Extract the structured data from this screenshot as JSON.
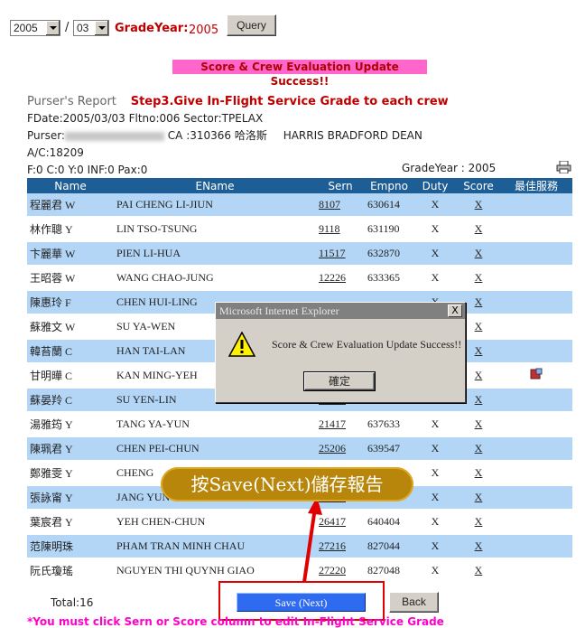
{
  "top": {
    "year_value": "2005",
    "slash": "/",
    "month_value": "03",
    "grade_year_label": "GradeYear:",
    "grade_year_value": "2005",
    "query_label": "Query"
  },
  "success_banner": "Score & Crew Evaluation Update Success!!",
  "report": {
    "title": "Purser's Report",
    "step": "Step3.Give In-Flight Service Grade to each crew",
    "line2": "FDate:2005/03/03  Fltno:006  Sector:TPELAX",
    "purser_label": "Purser:",
    "purser_ca": "CA :310366 哈洛斯",
    "purser_name": "HARRIS BRADFORD DEAN",
    "ac": "A/C:18209",
    "pax": "F:0  C:0  Y:0 INF:0   Pax:0",
    "grade_year": "GradeYear : 2005"
  },
  "table": {
    "headers": [
      "Name",
      "EName",
      "Sern",
      "Empno",
      "Duty",
      "Score",
      "最佳服務"
    ],
    "rows": [
      {
        "name": "程麗君 W",
        "ename": "PAI CHENG LI-JIUN",
        "sern": "8107",
        "empno": "630614",
        "duty": "X",
        "score": "X"
      },
      {
        "name": "林作聰 Y",
        "ename": "LIN TSO-TSUNG",
        "sern": "9118",
        "empno": "631190",
        "duty": "X",
        "score": "X"
      },
      {
        "name": "卞麗華 W",
        "ename": "PIEN LI-HUA",
        "sern": "11517",
        "empno": "632870",
        "duty": "X",
        "score": "X"
      },
      {
        "name": "王昭蓉 W",
        "ename": "WANG CHAO-JUNG",
        "sern": "12226",
        "empno": "633365",
        "duty": "X",
        "score": "X"
      },
      {
        "name": "陳惠玲 F",
        "ename": "CHEN HUI-LING",
        "sern": "",
        "empno": "",
        "duty": "X",
        "score": "X"
      },
      {
        "name": "蘇雅文 W",
        "ename": "SU YA-WEN",
        "sern": "",
        "empno": "",
        "duty": "X",
        "score": "X"
      },
      {
        "name": "韓苔蘭 C",
        "ename": "HAN TAI-LAN",
        "sern": "",
        "empno": "",
        "duty": "X",
        "score": "X"
      },
      {
        "name": "甘明曄 C",
        "ename": "KAN MING-YEH",
        "sern": "",
        "empno": "",
        "duty": "X",
        "score": "X"
      },
      {
        "name": "蘇晏羚 C",
        "ename": "SU YEN-LIN",
        "sern": "20418",
        "empno": "637230",
        "duty": "X",
        "score": "X"
      },
      {
        "name": "湯雅筠 Y",
        "ename": "TANG YA-YUN",
        "sern": "21417",
        "empno": "637633",
        "duty": "X",
        "score": "X"
      },
      {
        "name": "陳珮君 Y",
        "ename": "CHEN PEI-CHUN",
        "sern": "25206",
        "empno": "639547",
        "duty": "X",
        "score": "X"
      },
      {
        "name": "鄭雅雯 Y",
        "ename": "CHENG",
        "sern": "",
        "empno": "",
        "duty": "X",
        "score": "X"
      },
      {
        "name": "張詠甯 Y",
        "ename": "JANG YUNG-NING",
        "sern": "25808",
        "empno": "640086",
        "duty": "X",
        "score": "X"
      },
      {
        "name": "葉宸君 Y",
        "ename": "YEH CHEN-CHUN",
        "sern": "26417",
        "empno": "640404",
        "duty": "X",
        "score": "X"
      },
      {
        "name": "范陳明珠",
        "ename": "PHAM TRAN MINH CHAU",
        "sern": "27216",
        "empno": "827044",
        "duty": "X",
        "score": "X"
      },
      {
        "name": "阮氏瓊瑤",
        "ename": "NGUYEN THI QUYNH GIAO",
        "sern": "27220",
        "empno": "827048",
        "duty": "X",
        "score": "X"
      }
    ]
  },
  "total": "Total:16",
  "save_label": "Save (Next)",
  "back_label": "Back",
  "note": "*You must click Sern or Score column to edit In-Flight Service Grade",
  "dialog": {
    "title": "Microsoft Internet Explorer",
    "close": "X",
    "message": "Score & Crew Evaluation  Update Success!!",
    "ok": "確定"
  },
  "callout": "按Save(Next)儲存報告",
  "colors": {
    "header": "#1e5e96",
    "row_blue": "#b3d6f7",
    "banner": "#ff66cc",
    "callout": "#b8860b",
    "highlight": "#e00000"
  }
}
